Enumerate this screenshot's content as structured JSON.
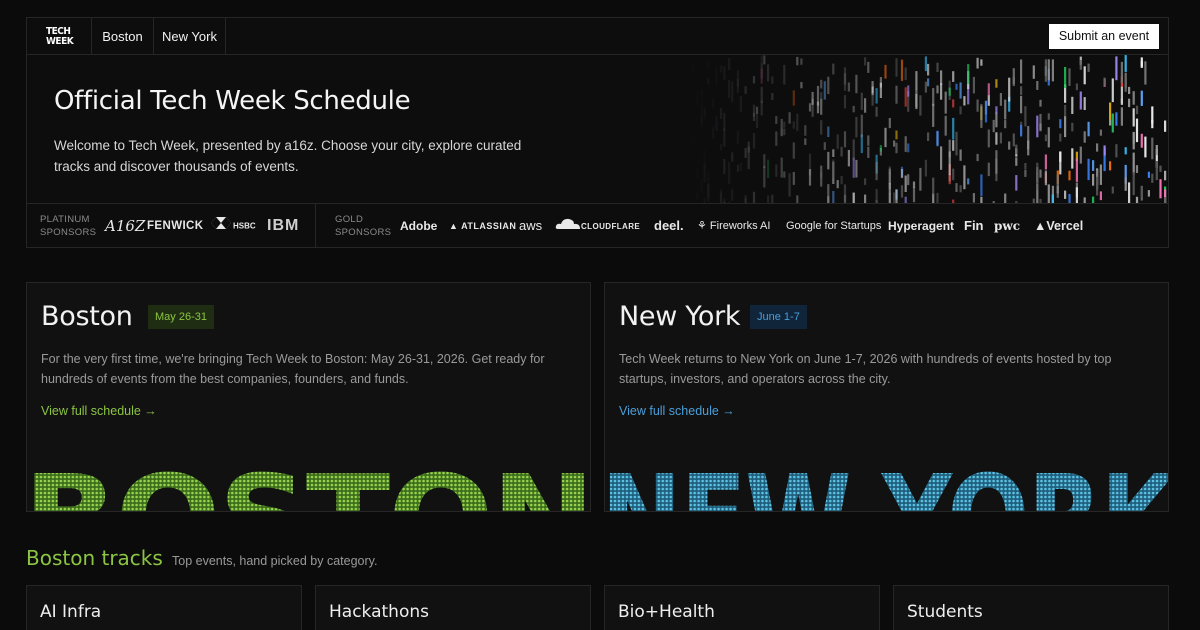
{
  "nav": {
    "logo_line1": "TECH",
    "logo_line2": "WEEK",
    "links": [
      "Boston",
      "New York"
    ],
    "submit_label": "Submit an event"
  },
  "hero": {
    "title": "Official Tech Week Schedule",
    "description": "Welcome to Tech Week, presented by a16z. Choose your city, explore curated tracks and discover thousands of events."
  },
  "sponsors": {
    "platinum_label_1": "PLATINUM",
    "platinum_label_2": "SPONSORS",
    "platinum": [
      "A16Z",
      "FENWICK",
      "HSBC",
      "IBM"
    ],
    "gold_label_1": "GOLD",
    "gold_label_2": "SPONSORS",
    "gold": [
      "Adobe",
      "ATLASSIAN",
      "aws",
      "CLOUDFLARE",
      "deel.",
      "Fireworks AI",
      "Google for Startups",
      "Hyperagent",
      "Fin",
      "pwc",
      "Vercel"
    ]
  },
  "cities": [
    {
      "name": "Boston",
      "dates": "May 26-31",
      "description": "For the very first time, we're bringing Tech Week to Boston: May 26-31, 2026. Get ready for hundreds of events from the best companies, founders, and funds.",
      "link": "View full schedule →",
      "art_text": "BOSTON",
      "accent": "#8cc443"
    },
    {
      "name": "New York",
      "dates": "June 1-7",
      "description": "Tech Week returns to New York on June 1-7, 2026 with hundreds of events hosted by top startups, investors, and operators across the city.",
      "link": "View full schedule →",
      "art_text": "NEW YORK",
      "accent": "#4a9fd8"
    }
  ],
  "tracks": {
    "title": "Boston tracks",
    "subtitle": "Top events, hand picked by category.",
    "items": [
      "AI Infra",
      "Hackathons",
      "Bio+Health",
      "Students"
    ]
  },
  "colors": {
    "background": "#0b0b0b",
    "boston_green": "#8cc443",
    "newyork_blue": "#4a9fd8"
  }
}
